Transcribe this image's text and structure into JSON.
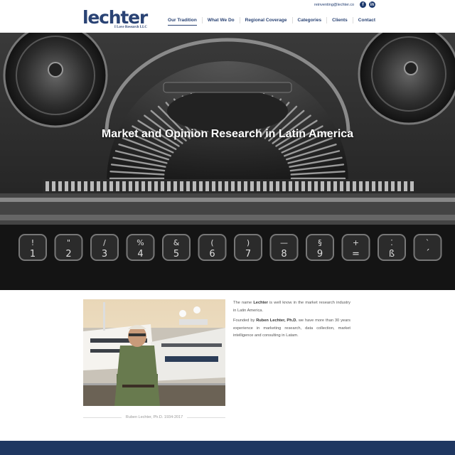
{
  "colors": {
    "brand": "#2a4374",
    "footer": "#1f3761"
  },
  "topbar": {
    "email": "reinventing@lechter.co",
    "social": [
      {
        "name": "facebook-icon",
        "glyph": "f"
      },
      {
        "name": "linkedin-icon",
        "glyph": "in"
      }
    ]
  },
  "logo": {
    "word": "lechter",
    "tagline": "I Love Research LLC"
  },
  "nav": {
    "items": [
      {
        "label": "Our Tradition",
        "active": true
      },
      {
        "label": "What We Do"
      },
      {
        "label": "Regional Coverage"
      },
      {
        "label": "Categories"
      },
      {
        "label": "Clients"
      },
      {
        "label": "Contact"
      }
    ]
  },
  "hero": {
    "title": "Market and Opinion Research in Latin America"
  },
  "about": {
    "p1_before": "The name ",
    "p1_bold": "Lechter",
    "p1_after": " is well know in the market research industry in Latin America.",
    "p2_before": "Founded by ",
    "p2_bold": "Ruben Lechter, Ph.D.",
    "p2_after": " we have more than 30 years experience in marketing research, data collection, market intelligence and consulting in Latam.",
    "caption": "Ruben Lechter, Ph.D. 1934-2017"
  },
  "typewriter_keys": [
    {
      "top": "!",
      "bottom": "1"
    },
    {
      "top": "\"",
      "bottom": "2"
    },
    {
      "top": "/",
      "bottom": "3"
    },
    {
      "top": "%",
      "bottom": "4"
    },
    {
      "top": "&",
      "bottom": "5"
    },
    {
      "top": "(",
      "bottom": "6"
    },
    {
      "top": ")",
      "bottom": "7"
    },
    {
      "top": "—",
      "bottom": "8"
    },
    {
      "top": "§",
      "bottom": "9"
    },
    {
      "top": "+",
      "bottom": "="
    },
    {
      "top": "⁚",
      "bottom": "ß"
    },
    {
      "top": "`",
      "bottom": "´"
    }
  ]
}
